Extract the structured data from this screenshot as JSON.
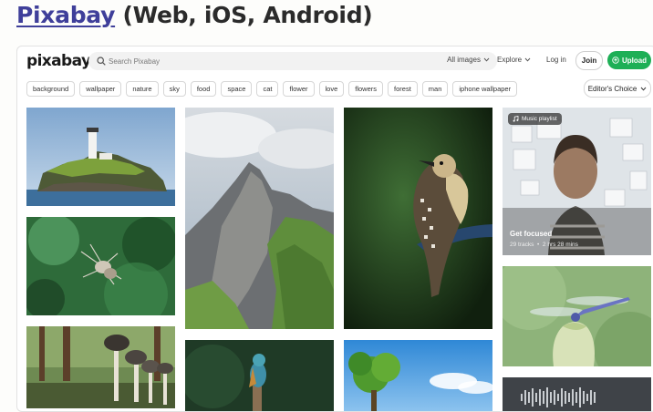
{
  "page": {
    "title_link": "Pixabay",
    "title_rest": " (Web, iOS, Android)"
  },
  "header": {
    "logo": "pixabay",
    "search_placeholder": "Search Pixabay",
    "scope_label": "All images",
    "explore_label": "Explore",
    "login_label": "Log in",
    "join_label": "Join",
    "upload_label": "Upload"
  },
  "tags": [
    "background",
    "wallpaper",
    "nature",
    "sky",
    "food",
    "space",
    "cat",
    "flower",
    "love",
    "flowers",
    "forest",
    "man",
    "iphone wallpaper"
  ],
  "sort": {
    "label": "Editor's Choice"
  },
  "playlist": {
    "badge": "Music playlist",
    "title": "Get focused",
    "tracks": "29 tracks",
    "separator": "•",
    "duration": "2 hrs 28 mins"
  },
  "icons": {
    "search": "search-icon",
    "chevron": "chevron-down-icon",
    "upload": "upload-icon",
    "music": "music-note-icon"
  },
  "colors": {
    "accent": "#1eaf56",
    "title_link": "#3f3f9a"
  }
}
